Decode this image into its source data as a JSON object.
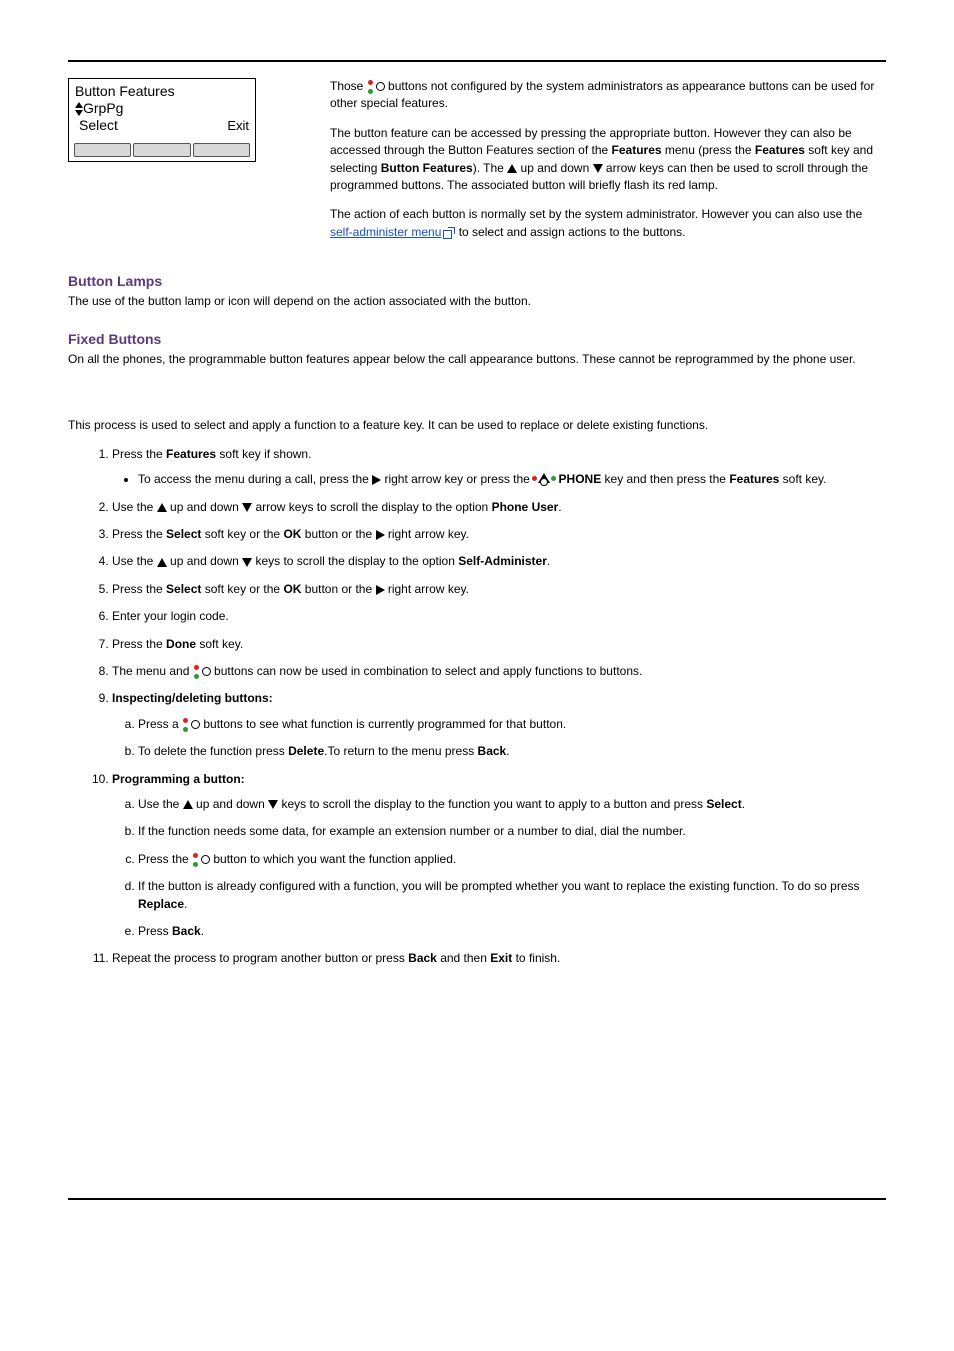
{
  "lcd": {
    "title": "Button Features",
    "line2_left": "GrpPg",
    "select": "Select",
    "exit": "Exit"
  },
  "intro": {
    "p1_a": "Those ",
    "p1_b": " buttons not configured by the system administrators as appearance buttons can be used for other special features.",
    "p2_a": "The button feature can be accessed by pressing the appropriate button. However they can also be accessed through the Button Features section of the ",
    "p2_b": " menu (press the ",
    "p2_c": " soft key and selecting ",
    "p2_d": "). The ",
    "p2_e": " up and down ",
    "p2_f": " arrow keys can then be used to scroll through the programmed buttons. The associated button will briefly flash its red lamp.",
    "p3_a": "The action of each button is normally set by the system administrator. However you can also use the ",
    "link_self_admin": "self-administer menu",
    "p3_b": " to select and assign actions to the buttons."
  },
  "kw": {
    "features": "Features",
    "button_features": "Button Features",
    "phone": "PHONE",
    "phone_user": "Phone User",
    "select": "Select",
    "ok": "OK",
    "self_administer": "Self-Administer",
    "done": "Done",
    "delete": "Delete",
    "back": "Back",
    "replace": "Replace",
    "exit": "Exit"
  },
  "sections": {
    "lamps_h": "Button Lamps",
    "lamps_p": "The use of the button lamp or icon will depend on the action associated with the button.",
    "fixed_h": "Fixed Buttons",
    "fixed_p": "On all the phones, the programmable button features appear below the call appearance buttons. These cannot be reprogrammed by the phone user."
  },
  "process_intro": "This process is used to select and apply a function to a feature key. It can be used to replace or delete existing functions.",
  "steps": {
    "s1_a": "Press the ",
    "s1_b": " soft key if shown.",
    "s1_bullet_a": "To access the menu during a call, press the ",
    "s1_bullet_b": " right arrow key or press the ",
    "s1_bullet_c": " key and then press the ",
    "s1_bullet_d": " soft key.",
    "s2_a": "Use the ",
    "s2_b": " up and down ",
    "s2_c": " arrow keys to scroll the display to the option ",
    "s2_d": ".",
    "s3_a": "Press the ",
    "s3_b": " soft key or the ",
    "s3_c": " button or the ",
    "s3_d": " right arrow key.",
    "s4_a": "Use the ",
    "s4_b": " up and down  ",
    "s4_c": " keys to scroll the display to the option ",
    "s4_d": ".",
    "s5_a": "Press the ",
    "s5_b": " soft key or the ",
    "s5_c": " button or the ",
    "s5_d": " right arrow key.",
    "s6": "Enter your login code.",
    "s7_a": "Press the ",
    "s7_b": " soft key.",
    "s8_a": "The menu and ",
    "s8_b": " buttons can now be used in combination to select and apply functions to buttons.",
    "s9_h": "Inspecting/deleting buttons:",
    "s9a_a": "Press a  ",
    "s9a_b": " buttons to see what function is currently programmed for that button.",
    "s9b_a": "To delete the function press ",
    "s9b_b": ".To return to the menu press ",
    "s9b_c": ".",
    "s10_h": "Programming a button:",
    "s10a_a": "Use the ",
    "s10a_b": " up and down  ",
    "s10a_c": " keys to scroll the display to the function you want to apply to a button and press ",
    "s10a_d": ".",
    "s10b": "If the function needs some data, for example an extension number or a number to dial, dial the number.",
    "s10c_a": "Press the ",
    "s10c_b": " button to which you want the function applied.",
    "s10d_a": "If the button is already configured with a function, you will be prompted whether you want to replace the existing function. To do so press ",
    "s10d_b": ".",
    "s10e_a": "Press ",
    "s10e_b": ".",
    "s11_a": "Repeat the process to program another button or press ",
    "s11_b": " and then ",
    "s11_c": " to finish."
  }
}
